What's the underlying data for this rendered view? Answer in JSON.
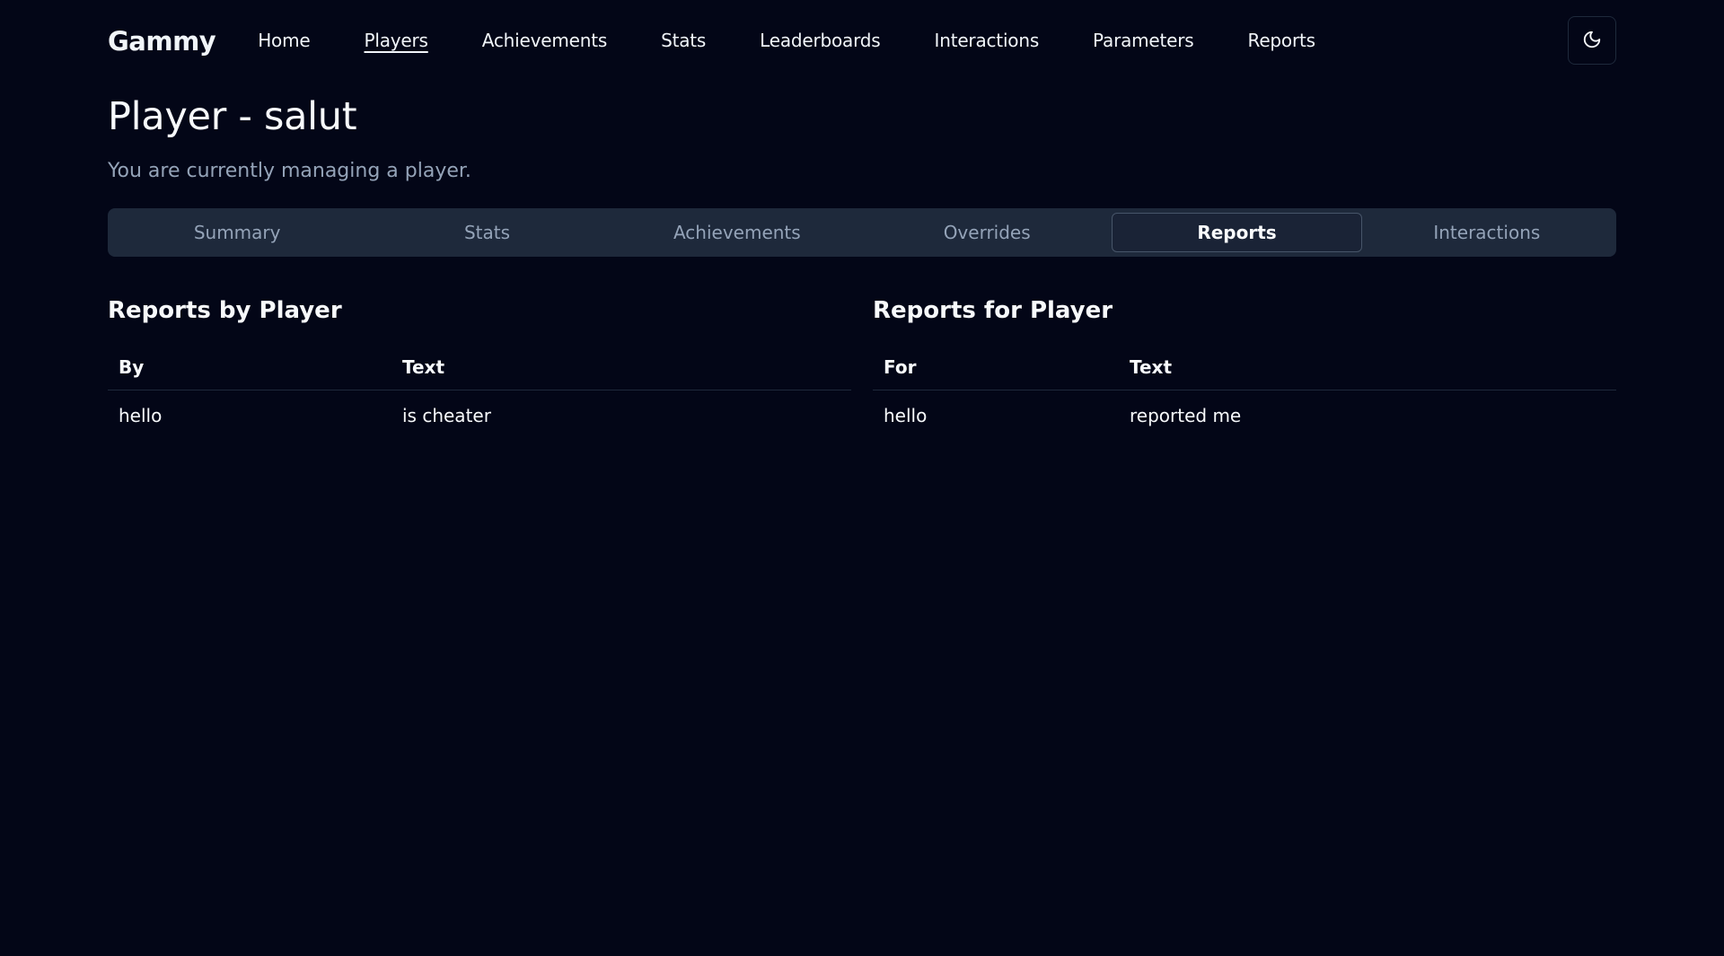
{
  "app": {
    "brand": "Gammy"
  },
  "nav": {
    "items": [
      {
        "label": "Home",
        "active": false
      },
      {
        "label": "Players",
        "active": true
      },
      {
        "label": "Achievements",
        "active": false
      },
      {
        "label": "Stats",
        "active": false
      },
      {
        "label": "Leaderboards",
        "active": false
      },
      {
        "label": "Interactions",
        "active": false
      },
      {
        "label": "Parameters",
        "active": false
      },
      {
        "label": "Reports",
        "active": false
      }
    ],
    "theme_toggle_icon": "moon-icon"
  },
  "page": {
    "title": "Player - salut",
    "subtitle": "You are currently managing a player."
  },
  "tabs": {
    "items": [
      {
        "label": "Summary",
        "active": false
      },
      {
        "label": "Stats",
        "active": false
      },
      {
        "label": "Achievements",
        "active": false
      },
      {
        "label": "Overrides",
        "active": false
      },
      {
        "label": "Reports",
        "active": true
      },
      {
        "label": "Interactions",
        "active": false
      }
    ]
  },
  "reports_by_player": {
    "title": "Reports by Player",
    "columns": [
      "By",
      "Text"
    ],
    "rows": [
      [
        "hello",
        "is cheater"
      ]
    ]
  },
  "reports_for_player": {
    "title": "Reports for Player",
    "columns": [
      "For",
      "Text"
    ],
    "rows": [
      [
        "hello",
        "reported me"
      ]
    ]
  },
  "colors": {
    "background": "#030617",
    "tab_bar": "#1e293b",
    "muted_text": "#94a3b8",
    "text": "#f8fafc"
  }
}
